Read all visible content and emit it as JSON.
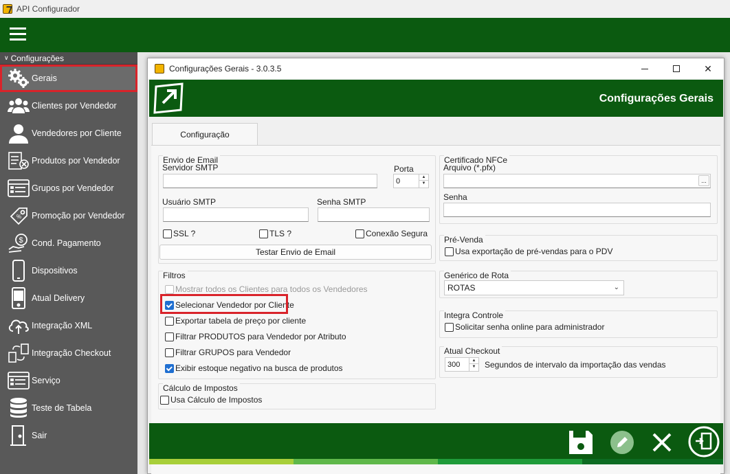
{
  "app": {
    "title": "API Configurador"
  },
  "sidebar": {
    "section_label": "Configurações",
    "items": [
      {
        "label": "Gerais",
        "icon": "gears-icon",
        "active": true
      },
      {
        "label": "Clientes por Vendedor",
        "icon": "users-icon"
      },
      {
        "label": "Vendedores por Cliente",
        "icon": "user-icon"
      },
      {
        "label": "Produtos por Vendedor",
        "icon": "product-list-icon"
      },
      {
        "label": "Grupos por Vendedor",
        "icon": "group-list-icon"
      },
      {
        "label": "Promoção por Vendedor",
        "icon": "price-tag-icon"
      },
      {
        "label": "Cond. Pagamento",
        "icon": "hand-coin-icon"
      },
      {
        "label": "Dispositivos",
        "icon": "phone-icon"
      },
      {
        "label": "Atual Delivery",
        "icon": "tablet-icon"
      },
      {
        "label": "Integração XML",
        "icon": "cloud-upload-icon"
      },
      {
        "label": "Integração Checkout",
        "icon": "transfer-icon"
      },
      {
        "label": "Serviço",
        "icon": "service-list-icon"
      },
      {
        "label": "Teste de Tabela",
        "icon": "database-icon"
      },
      {
        "label": "Sair",
        "icon": "exit-door-icon"
      }
    ]
  },
  "dialog": {
    "title": "Configurações Gerais - 3.0.3.5",
    "banner_title": "Configurações Gerais",
    "tab_label": "Configuração",
    "email": {
      "group_label": "Envio de Email",
      "smtp_server_label": "Servidor SMTP",
      "smtp_server_value": "",
      "port_label": "Porta",
      "port_value": "0",
      "smtp_user_label": "Usuário SMTP",
      "smtp_password_label": "Senha SMTP",
      "ssl_label": "SSL ?",
      "tls_label": "TLS ?",
      "secure_label": "Conexão Segura",
      "test_button": "Testar Envio de Email"
    },
    "filters": {
      "group_label": "Filtros",
      "items": [
        {
          "label": "Mostrar todos os Clientes para todos os Vendedores",
          "checked": false,
          "disabled": true
        },
        {
          "label": "Selecionar Vendedor por Cliente",
          "checked": true,
          "highlighted": true
        },
        {
          "label": "Exportar tabela de preço por cliente",
          "checked": false
        },
        {
          "label": "Filtrar PRODUTOS para Vendedor por Atributo",
          "checked": false
        },
        {
          "label": "Filtrar GRUPOS para Vendedor",
          "checked": false
        },
        {
          "label": "Exibir estoque negativo na busca de produtos",
          "checked": true
        }
      ]
    },
    "taxes": {
      "group_label": "Cálculo de Impostos",
      "use_label": "Usa Cálculo de Impostos"
    },
    "nfce": {
      "group_label": "Certificado NFCe",
      "file_label": "Arquivo (*.pfx)",
      "password_label": "Senha",
      "browse_label": "..."
    },
    "presale": {
      "group_label": "Pré-Venda",
      "export_label": "Usa exportação de pré-vendas para o PDV"
    },
    "route": {
      "group_label": "Genérico de Rota",
      "selected": "ROTAS"
    },
    "integra": {
      "group_label": "Integra Controle",
      "online_password_label": "Solicitar senha online para administrador"
    },
    "checkout": {
      "group_label": "Atual Checkout",
      "interval_value": "300",
      "interval_label": "Segundos de intervalo da importação das vendas"
    },
    "footer": {
      "buttons": [
        "save-icon",
        "edit-icon",
        "close-x-icon",
        "exit-icon"
      ]
    }
  },
  "colors": {
    "brand_green": "#0b5a10",
    "highlight_red": "#d9232a",
    "check_blue": "#1f6fd1"
  }
}
